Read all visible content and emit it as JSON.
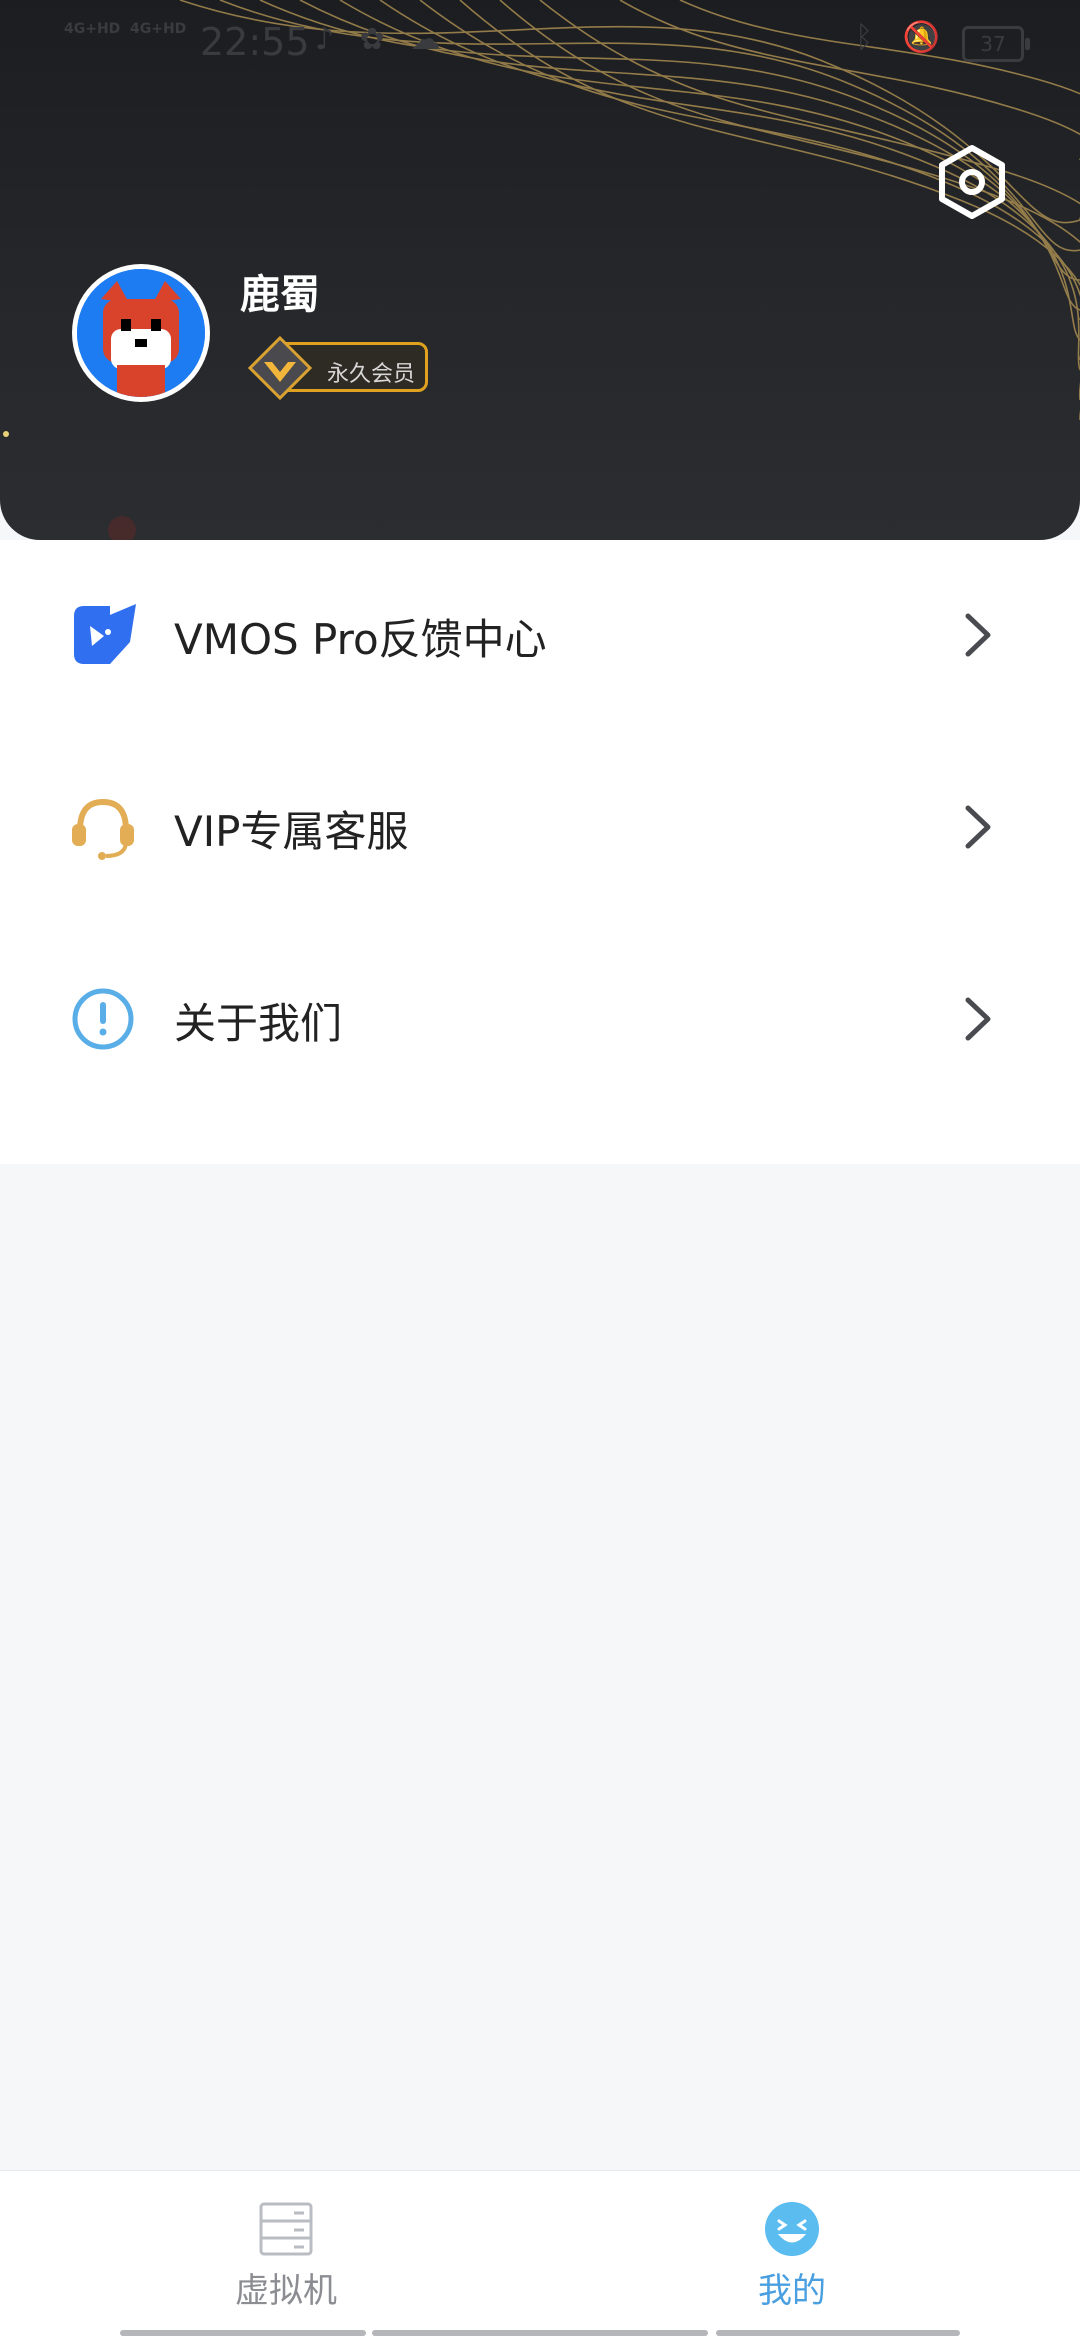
{
  "status_bar": {
    "signal_1": "4G+HD",
    "signal_2": "4G+HD",
    "time": "22:55",
    "battery": "37"
  },
  "profile": {
    "username": "鹿蜀",
    "membership_badge": "永久会员"
  },
  "menu": {
    "items": [
      {
        "label": "VMOS Pro反馈中心",
        "icon": "feedback-rabbit-icon"
      },
      {
        "label": "VIP专属客服",
        "icon": "headset-icon"
      },
      {
        "label": "关于我们",
        "icon": "info-exclamation-icon"
      }
    ]
  },
  "tabbar": {
    "tabs": [
      {
        "label": "虚拟机",
        "icon": "server-rack-icon",
        "active": false
      },
      {
        "label": "我的",
        "icon": "smiley-face-icon",
        "active": true
      }
    ]
  },
  "colors": {
    "accent": "#4a9fe0",
    "gold": "#e0a21e",
    "header_bg": "#222428",
    "feedback_blue": "#2f6ff0",
    "headset_gold": "#e2ad55",
    "info_blue": "#5aaee8"
  }
}
